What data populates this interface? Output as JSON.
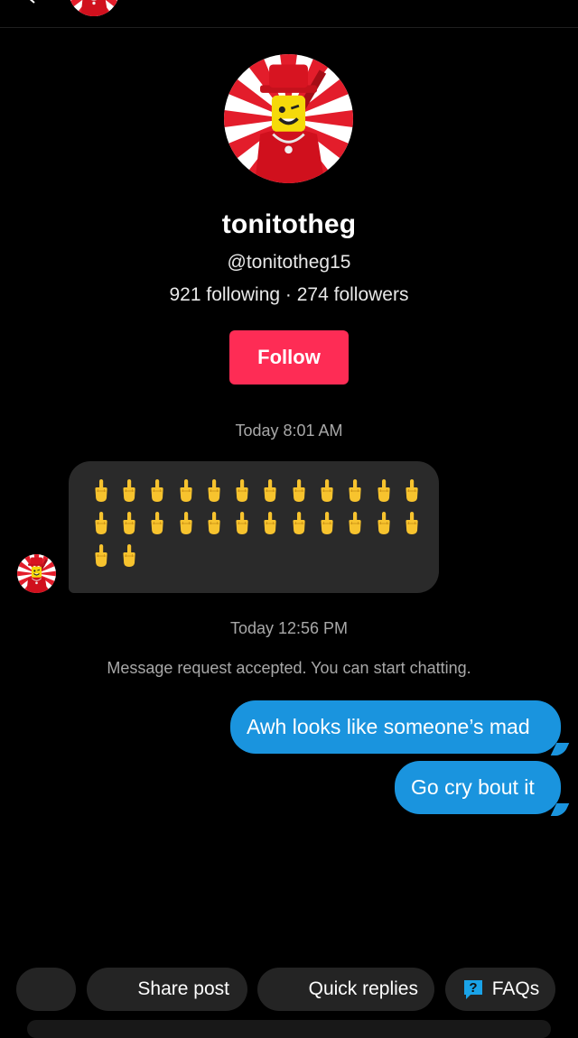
{
  "profile": {
    "display_name": "tonitotheg",
    "handle": "@tonitotheg15",
    "stats": "921 following · 274 followers",
    "follow_label": "Follow"
  },
  "messages": {
    "timestamp_1": "Today 8:01 AM",
    "emoji_count": 26,
    "emoji_icon": "middle-finger-emoji",
    "timestamp_2": "Today 12:56 PM",
    "notice": "Message request accepted. You can start chatting.",
    "outgoing": [
      "Awh looks like someone’s mad",
      "Go cry bout it"
    ]
  },
  "quick_actions": {
    "share_post": "Share post",
    "quick_replies": "Quick replies",
    "faqs": "FAQs"
  },
  "colors": {
    "accent": "#fe2c55",
    "outgoing_bubble": "#1a94de",
    "incoming_bubble": "#2a2a2a"
  }
}
